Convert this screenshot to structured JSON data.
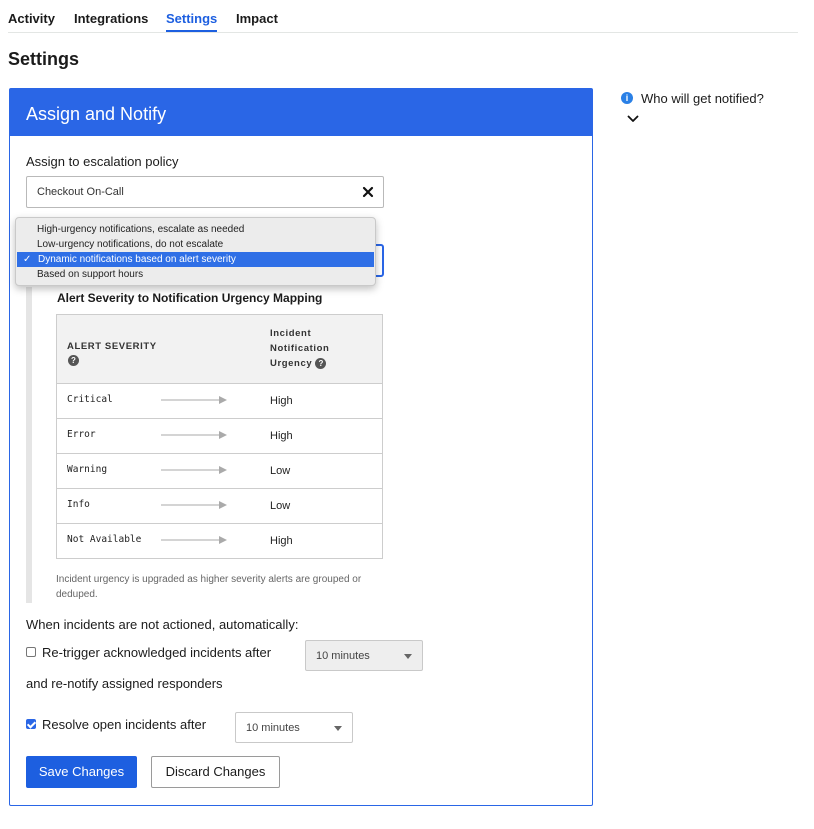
{
  "tabs": [
    {
      "label": "Activity"
    },
    {
      "label": "Integrations"
    },
    {
      "label": "Settings"
    },
    {
      "label": "Impact"
    }
  ],
  "page_title": "Settings",
  "card": {
    "title": "Assign and Notify",
    "assign_label": "Assign to escalation policy",
    "policy_value": "Checkout On-Call",
    "dropdown_options": [
      "High-urgency notifications, escalate as needed",
      "Low-urgency notifications, do not escalate",
      "Dynamic notifications based on alert severity",
      "Based on support hours"
    ],
    "dropdown_selected": "Dynamic notifications based on alert severity",
    "mapping": {
      "title": "Alert Severity to Notification Urgency Mapping",
      "col_severity": "Alert Severity",
      "col_urgency": "Incident Notification Urgency",
      "rows": [
        {
          "severity": "Critical",
          "urgency": "High"
        },
        {
          "severity": "Error",
          "urgency": "High"
        },
        {
          "severity": "Warning",
          "urgency": "Low"
        },
        {
          "severity": "Info",
          "urgency": "Low"
        },
        {
          "severity": "Not Available",
          "urgency": "High"
        }
      ],
      "note": "Incident urgency is upgraded as higher severity alerts are grouped or deduped."
    },
    "auto_heading": "When incidents are not actioned, automatically:",
    "retrigger": {
      "label": "Re-trigger acknowledged incidents after",
      "sub_label": "and re-notify assigned responders",
      "checked": false,
      "value": "10 minutes"
    },
    "resolve": {
      "label": "Resolve open incidents after",
      "checked": true,
      "value": "10 minutes"
    },
    "save_label": "Save Changes",
    "discard_label": "Discard Changes"
  },
  "side": {
    "who_label": "Who will get notified?"
  },
  "colors": {
    "accent": "#2a66e6",
    "tab_active": "#1d5fe0",
    "info": "#2a80e6"
  },
  "icons": [
    "info-icon",
    "chevron-down-icon",
    "close-icon",
    "help-icon",
    "arrow-right-icon",
    "checkmark-icon",
    "caret-down-icon"
  ]
}
